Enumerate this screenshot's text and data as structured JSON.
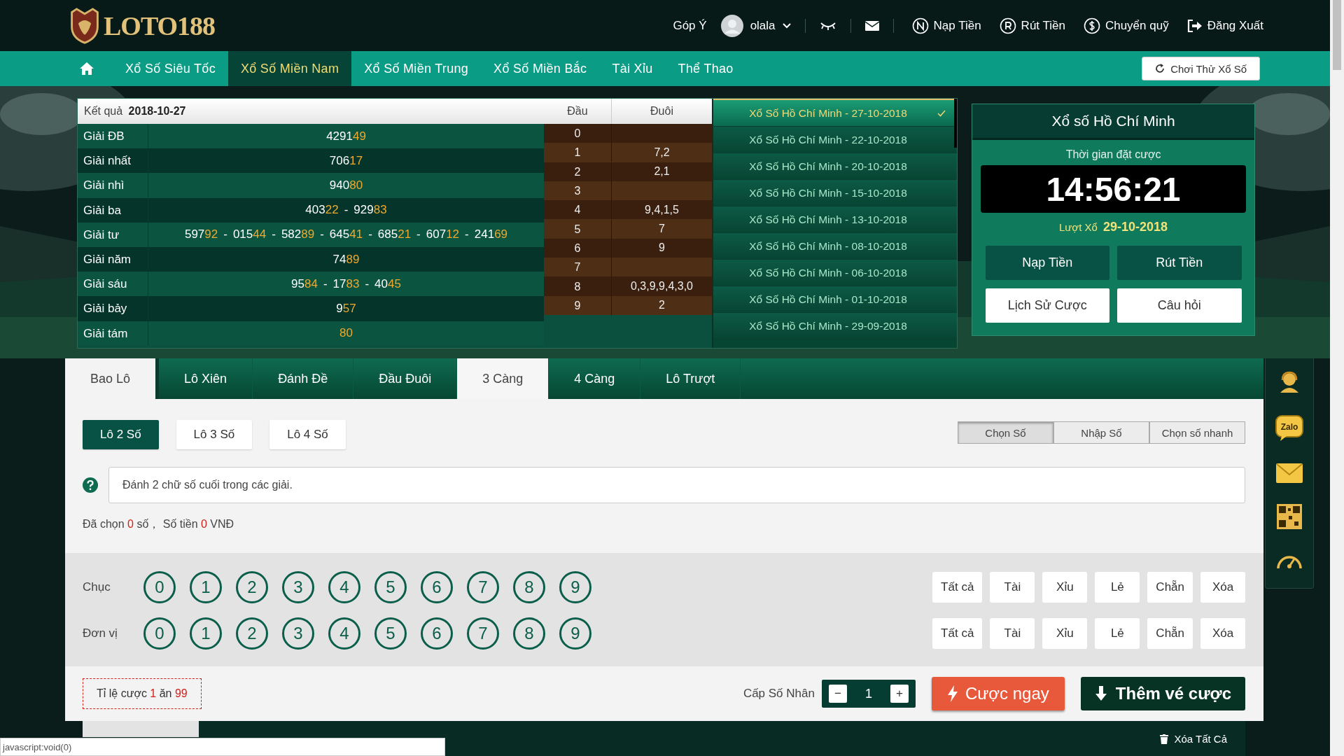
{
  "header": {
    "logo": "LOTO188",
    "feedback": "Góp Ý",
    "user": "olala",
    "links": [
      {
        "label": "Nạp Tiền",
        "kind": "deposit"
      },
      {
        "label": "Rút Tiền",
        "kind": "withdraw"
      },
      {
        "label": "Chuyển quỹ",
        "kind": "transfer"
      },
      {
        "label": "Đăng Xuất",
        "kind": "logout"
      }
    ]
  },
  "nav": {
    "items": [
      {
        "label": "Xổ Số Siêu Tốc",
        "selected": false
      },
      {
        "label": "Xổ Số Miền Nam",
        "selected": true
      },
      {
        "label": "Xổ Số Miền Trung",
        "selected": false
      },
      {
        "label": "Xổ Số Miền Bắc",
        "selected": false
      },
      {
        "label": "Tài Xỉu",
        "selected": false
      },
      {
        "label": "Thể Thao",
        "selected": false
      }
    ],
    "try_button": "Chơi Thử Xổ Số"
  },
  "results": {
    "label": "Kết quả",
    "date": "2018-10-27",
    "separator": "-",
    "columns": [
      "Đầu",
      "Đuôi"
    ],
    "prizes": [
      {
        "name": "Giải ĐB",
        "numbers": [
          {
            "head": "4291",
            "tail": "49"
          }
        ]
      },
      {
        "name": "Giải nhất",
        "numbers": [
          {
            "head": "706",
            "tail": "17"
          }
        ]
      },
      {
        "name": "Giải nhì",
        "numbers": [
          {
            "head": "940",
            "tail": "80"
          }
        ]
      },
      {
        "name": "Giải ba",
        "numbers": [
          {
            "head": "403",
            "tail": "22"
          },
          {
            "head": "929",
            "tail": "83"
          }
        ]
      },
      {
        "name": "Giải tư",
        "numbers": [
          {
            "head": "597",
            "tail": "92"
          },
          {
            "head": "015",
            "tail": "44"
          },
          {
            "head": "582",
            "tail": "89"
          },
          {
            "head": "645",
            "tail": "41"
          },
          {
            "head": "685",
            "tail": "21"
          },
          {
            "head": "607",
            "tail": "12"
          },
          {
            "head": "241",
            "tail": "69"
          }
        ]
      },
      {
        "name": "Giải năm",
        "numbers": [
          {
            "head": "74",
            "tail": "89"
          }
        ]
      },
      {
        "name": "Giải sáu",
        "numbers": [
          {
            "head": "95",
            "tail": "84"
          },
          {
            "head": "17",
            "tail": "83"
          },
          {
            "head": "40",
            "tail": "45"
          }
        ]
      },
      {
        "name": "Giải bảy",
        "numbers": [
          {
            "head": "9",
            "tail": "57"
          }
        ]
      },
      {
        "name": "Giải tám",
        "numbers": [
          {
            "tail": "80"
          }
        ]
      }
    ],
    "dau_duoi": [
      {
        "dau": "0"
      },
      {
        "dau": "1",
        "duoi": "7,2"
      },
      {
        "dau": "2",
        "duoi": "2,1"
      },
      {
        "dau": "3"
      },
      {
        "dau": "4",
        "duoi": "9,4,1,5"
      },
      {
        "dau": "5",
        "duoi": "7"
      },
      {
        "dau": "6",
        "duoi": "9"
      },
      {
        "dau": "7"
      },
      {
        "dau": "8",
        "duoi": "0,3,9,9,4,3,0"
      },
      {
        "dau": "9",
        "duoi": "2"
      }
    ]
  },
  "draws": [
    {
      "label": "Xổ Số Hồ Chí Minh - 27-10-2018",
      "selected": true
    },
    {
      "label": "Xổ Số Hồ Chí Minh - 22-10-2018",
      "selected": false
    },
    {
      "label": "Xổ Số Hồ Chí Minh - 20-10-2018",
      "selected": false
    },
    {
      "label": "Xổ Số Hồ Chí Minh - 15-10-2018",
      "selected": false
    },
    {
      "label": "Xổ Số Hồ Chí Minh - 13-10-2018",
      "selected": false
    },
    {
      "label": "Xổ Số Hồ Chí Minh - 08-10-2018",
      "selected": false
    },
    {
      "label": "Xổ Số Hồ Chí Minh - 06-10-2018",
      "selected": false
    },
    {
      "label": "Xổ Số Hồ Chí Minh - 01-10-2018",
      "selected": false
    },
    {
      "label": "Xổ Số Hồ Chí Minh - 29-09-2018",
      "selected": false
    }
  ],
  "panel": {
    "title": "Xổ số Hồ Chí Minh",
    "timer_label": "Thời gian đặt cược",
    "timer": "14:56:21",
    "draw_label": "Lượt Xổ",
    "draw_date": "29-10-2018",
    "buttons": [
      {
        "label": "Nạp Tiền",
        "kind": "primary"
      },
      {
        "label": "Rút Tiền",
        "kind": "primary"
      },
      {
        "label": "Lịch Sử Cược",
        "kind": "secondary"
      },
      {
        "label": "Câu hỏi",
        "kind": "secondary"
      }
    ]
  },
  "bet_tabs": [
    {
      "label": "Bao Lô",
      "selected": true,
      "hovered": false
    },
    {
      "label": "Lô Xiên",
      "selected": false,
      "hovered": false
    },
    {
      "label": "Đánh Đề",
      "selected": false,
      "hovered": false
    },
    {
      "label": "Đầu Đuôi",
      "selected": false,
      "hovered": false
    },
    {
      "label": "3 Càng",
      "selected": false,
      "hovered": true
    },
    {
      "label": "4 Càng",
      "selected": false,
      "hovered": false
    },
    {
      "label": "Lô Trượt",
      "selected": false,
      "hovered": false
    }
  ],
  "sub_tabs": [
    {
      "label": "Lô 2 Số",
      "selected": true
    },
    {
      "label": "Lô 3 Số",
      "selected": false
    },
    {
      "label": "Lô 4 Số",
      "selected": false
    }
  ],
  "modes": [
    {
      "label": "Chọn Số",
      "selected": true
    },
    {
      "label": "Nhập Số",
      "selected": false
    },
    {
      "label": "Chọn số nhanh",
      "selected": false
    }
  ],
  "hint": "Đánh 2 chữ số cuối trong các giải.",
  "summary": {
    "chosen_label": "Đã chọn",
    "count": "0",
    "count_unit": "số，",
    "amount_label": "Số tiền",
    "amount": "0",
    "currency": "VNĐ"
  },
  "digit_rows": [
    {
      "label": "Chục",
      "digits": [
        {
          "label": "0",
          "selected": false
        },
        {
          "label": "1",
          "selected": false
        },
        {
          "label": "2",
          "selected": false
        },
        {
          "label": "3",
          "selected": false
        },
        {
          "label": "4",
          "selected": false
        },
        {
          "label": "5",
          "selected": false
        },
        {
          "label": "6",
          "selected": false
        },
        {
          "label": "7",
          "selected": false
        },
        {
          "label": "8",
          "selected": false
        },
        {
          "label": "9",
          "selected": false
        }
      ],
      "actions": [
        "Tất cả",
        "Tài",
        "Xỉu",
        "Lẻ",
        "Chẵn",
        "Xóa"
      ]
    },
    {
      "label": "Đơn vị",
      "digits": [
        {
          "label": "0",
          "selected": false
        },
        {
          "label": "1",
          "selected": false
        },
        {
          "label": "2",
          "selected": false
        },
        {
          "label": "3",
          "selected": false
        },
        {
          "label": "4",
          "selected": false
        },
        {
          "label": "5",
          "selected": false
        },
        {
          "label": "6",
          "selected": false
        },
        {
          "label": "7",
          "selected": false
        },
        {
          "label": "8",
          "selected": false
        },
        {
          "label": "9",
          "selected": false
        }
      ],
      "actions": [
        "Tất cả",
        "Tài",
        "Xỉu",
        "Lẻ",
        "Chẵn",
        "Xóa"
      ]
    }
  ],
  "odds": {
    "label": "Tỉ lệ cược",
    "stake": "1",
    "mid": "ăn",
    "payout": "99"
  },
  "multiplier": {
    "label": "Cấp Số Nhân",
    "minus": "−",
    "value": "1",
    "plus": "+"
  },
  "bet_button": "Cược ngay",
  "add_button": "Thêm vé cược",
  "clear_all": "Xóa Tất Cả",
  "sidebar": {
    "zalo": "Zalo"
  },
  "status_url": "javascript:void(0)"
}
